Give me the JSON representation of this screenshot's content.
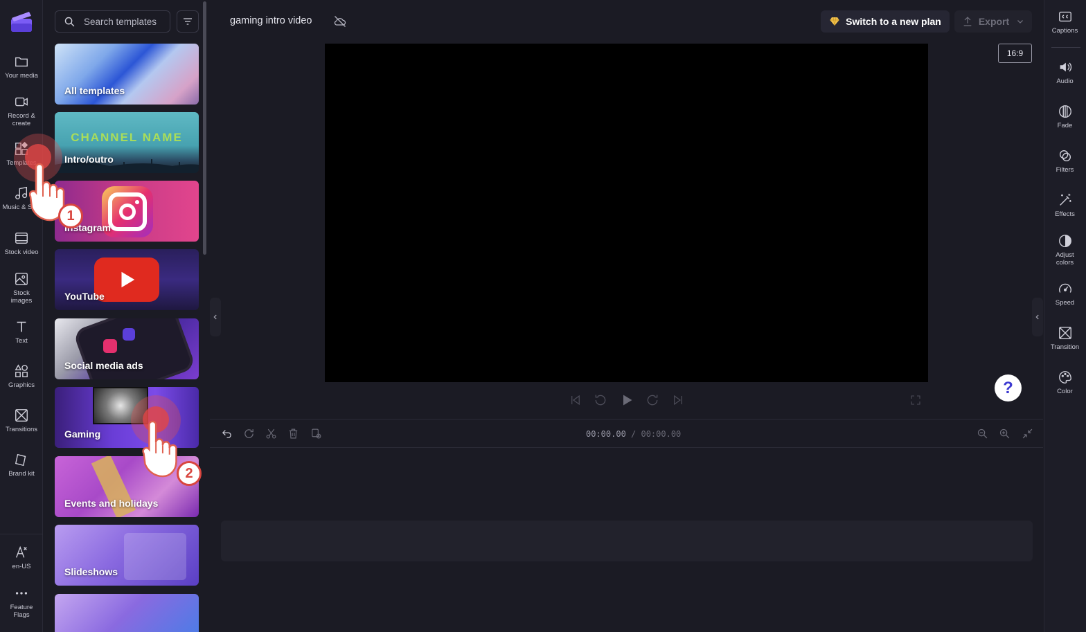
{
  "left_rail": {
    "items": [
      {
        "label": "Your media",
        "icon": "folder-icon"
      },
      {
        "label": "Record & create",
        "icon": "camera-icon"
      },
      {
        "label": "Templates",
        "icon": "templates-icon"
      },
      {
        "label": "Music & SFX",
        "icon": "music-icon"
      },
      {
        "label": "Stock video",
        "icon": "film-icon"
      },
      {
        "label": "Stock images",
        "icon": "image-icon"
      },
      {
        "label": "Text",
        "icon": "text-icon"
      },
      {
        "label": "Graphics",
        "icon": "shapes-icon"
      },
      {
        "label": "Transitions",
        "icon": "transition-icon"
      },
      {
        "label": "Brand kit",
        "icon": "brand-kit-icon"
      }
    ],
    "bottom": [
      {
        "label": "en-US",
        "icon": "language-icon"
      },
      {
        "label": "Feature Flags",
        "icon": "more-icon"
      }
    ]
  },
  "templates_panel": {
    "search_placeholder": "Search templates",
    "categories": [
      {
        "label": "All templates"
      },
      {
        "label": "Intro/outro",
        "art_text": "CHANNEL NAME"
      },
      {
        "label": "Instagram"
      },
      {
        "label": "YouTube"
      },
      {
        "label": "Social media ads"
      },
      {
        "label": "Gaming"
      },
      {
        "label": "Events and holidays"
      },
      {
        "label": "Slideshows"
      },
      {
        "label": ""
      }
    ]
  },
  "header": {
    "project_title": "gaming intro video",
    "upgrade_label": "Switch to a new plan",
    "export_label": "Export"
  },
  "preview": {
    "aspect_ratio": "16:9",
    "help_label": "?"
  },
  "timeline": {
    "current_time": "00:00.00",
    "total_time": "/ 00:00.00"
  },
  "right_rail": {
    "items": [
      {
        "label": "Captions",
        "icon": "captions-icon"
      },
      {
        "label": "Audio",
        "icon": "speaker-icon"
      },
      {
        "label": "Fade",
        "icon": "fade-icon"
      },
      {
        "label": "Filters",
        "icon": "filters-icon"
      },
      {
        "label": "Effects",
        "icon": "magic-wand-icon"
      },
      {
        "label": "Adjust colors",
        "icon": "contrast-icon"
      },
      {
        "label": "Speed",
        "icon": "speedometer-icon"
      },
      {
        "label": "Transition",
        "icon": "transition-icon"
      },
      {
        "label": "Color",
        "icon": "palette-icon"
      }
    ]
  },
  "annotations": {
    "step1": "1",
    "step2": "2"
  },
  "colors": {
    "accent": "#7c5cff",
    "annotation_red": "#d9463f",
    "background": "#1b1b24"
  }
}
